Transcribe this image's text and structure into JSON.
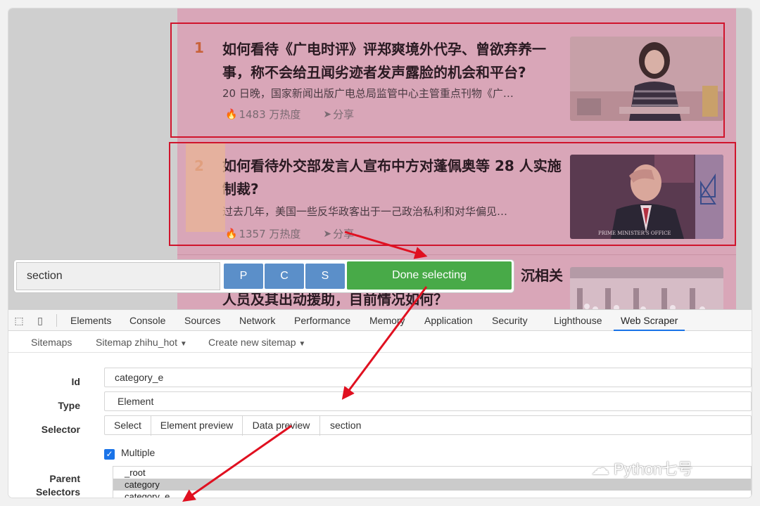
{
  "feed": {
    "items": [
      {
        "rank": "1",
        "title": "如何看待《广电时评》评郑爽境外代孕、曾欲弃养一事，称不会给丑闻劣迹者发声露脸的机会和平台?",
        "excerpt": "20 日晚，国家新闻出版广电总局监管中心主管重点刊物《广…",
        "heat": "1483 万热度",
        "share": "分享"
      },
      {
        "rank": "2",
        "title": "如何看待外交部发言人宣布中方对蓬佩奥等 28 人实施制裁?",
        "excerpt": "过去几年，美国一些反华政客出于一己政治私利和对华偏见…",
        "heat": "1357 万热度",
        "share": "分享"
      },
      {
        "title_fragment_line1": "沉相关",
        "title_fragment_line2": "人员及其出动援助，目前情况如何？"
      }
    ]
  },
  "toolbar": {
    "selector_value": "section",
    "btn_p": "P",
    "btn_c": "C",
    "btn_s": "S",
    "done": "Done selecting"
  },
  "devtools": {
    "tabs": [
      "Elements",
      "Console",
      "Sources",
      "Network",
      "Performance",
      "Memory",
      "Application",
      "Security",
      "Lighthouse",
      "Web Scraper"
    ],
    "active_tab": "Web Scraper"
  },
  "scraper_nav": {
    "sitemaps": "Sitemaps",
    "sitemap": "Sitemap zhihu_hot",
    "create": "Create new sitemap"
  },
  "form": {
    "id_label": "Id",
    "id_value": "category_e",
    "type_label": "Type",
    "type_value": "Element",
    "selector_label": "Selector",
    "select_btn": "Select",
    "element_preview_btn": "Element preview",
    "data_preview_btn": "Data preview",
    "selector_value": "section",
    "multiple_label": "Multiple",
    "multiple_checked": true,
    "parent_label_line1": "Parent",
    "parent_label_line2": "Selectors",
    "parent_options": [
      "_root",
      "category",
      "category_e"
    ],
    "parent_selected": "category"
  },
  "watermark": "Python七号",
  "colors": {
    "accent_blue": "#5b8fc9",
    "done_green": "#48aa48",
    "highlight_red": "#d0142c",
    "feed_overlay": "#d9a6b8"
  }
}
